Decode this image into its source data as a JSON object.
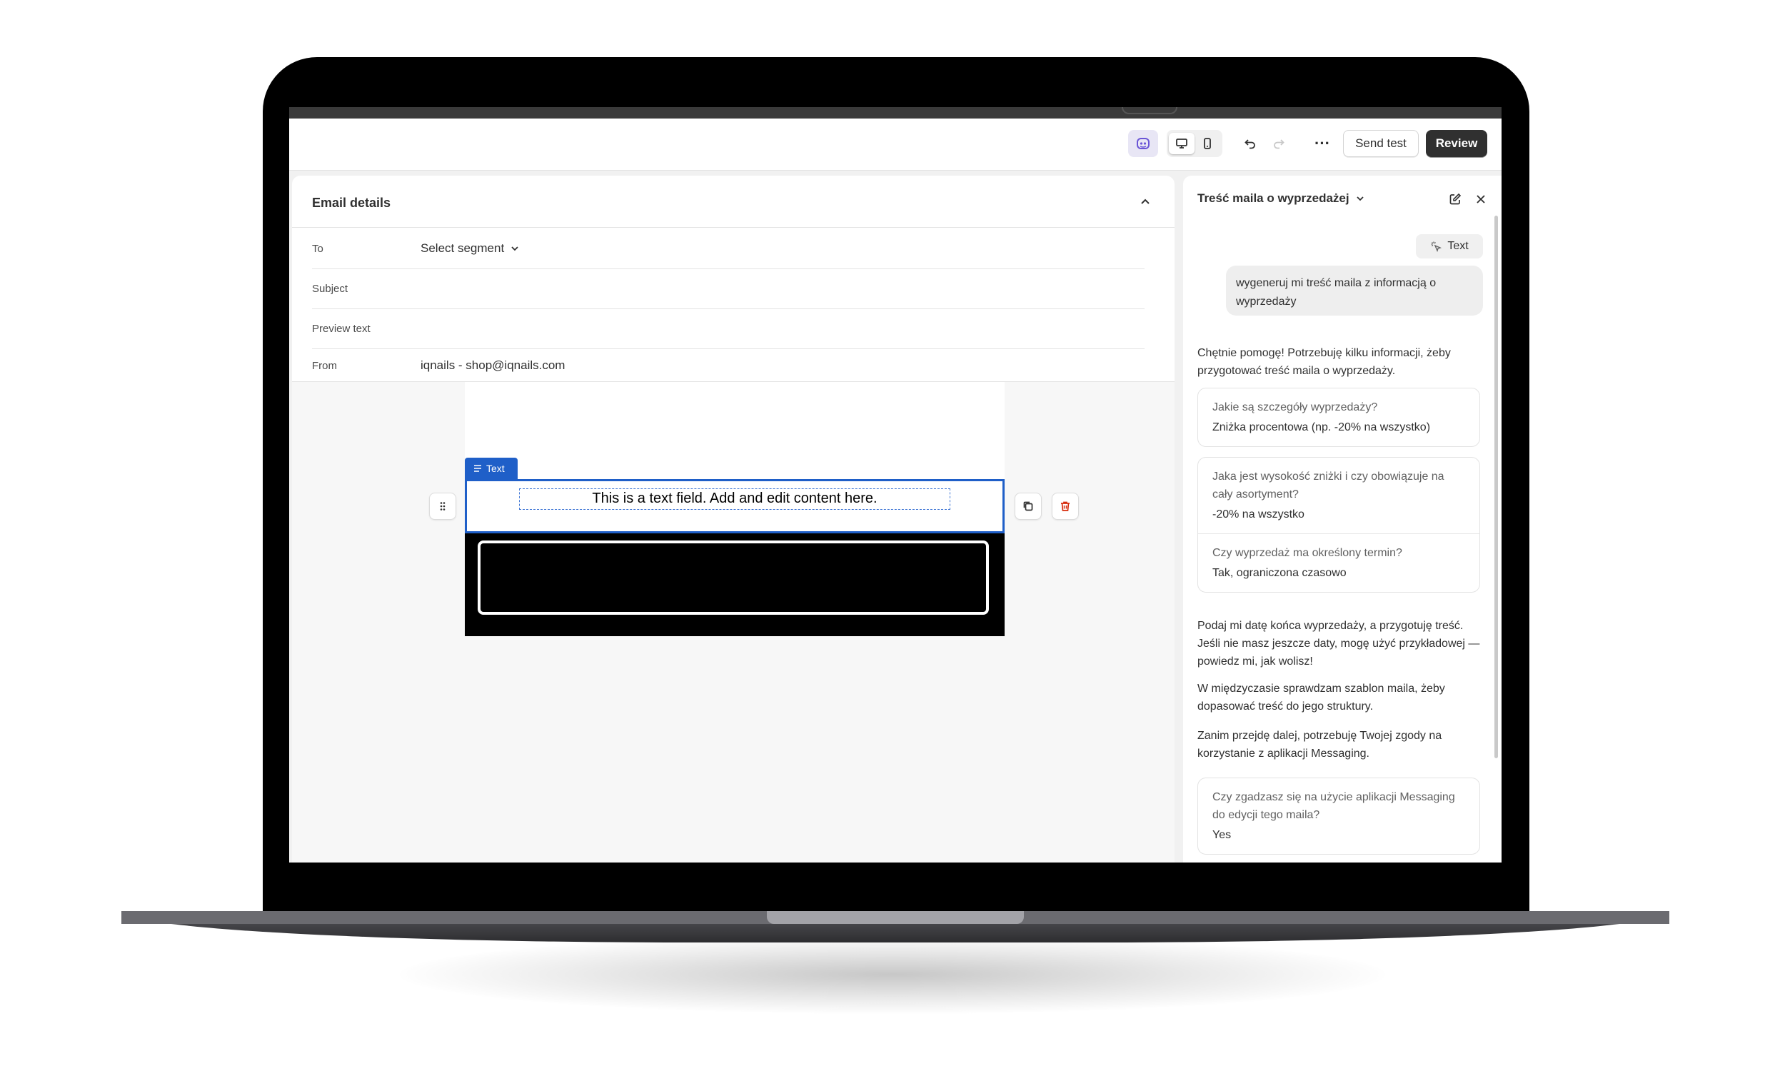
{
  "toolbar": {
    "send_test_label": "Send test",
    "review_label": "Review",
    "ai_icon": "sparkle-face-icon",
    "desktop_icon": "desktop-icon",
    "mobile_icon": "mobile-icon",
    "more_label": "···"
  },
  "email_details": {
    "title": "Email details",
    "fields": [
      {
        "label": "To",
        "value": "Select segment"
      },
      {
        "label": "Subject",
        "value": ""
      },
      {
        "label": "Preview text",
        "value": ""
      },
      {
        "label": "From",
        "value": "iqnails - shop@iqnails.com"
      }
    ]
  },
  "editor": {
    "block_tag": "Text",
    "text_field": "This is a text field. Add and edit content here."
  },
  "assistant": {
    "title": "Treść maila o wyprzedażej",
    "chip_label": "Text",
    "user_message": "wygeneruj mi treść maila z informacją o wyprzedaży",
    "reply_1": "Chętnie pomogę! Potrzebuję kilku informacji, żeby przygotować treść maila o wyprzedaży.",
    "qa_1": [
      {
        "q": "Jakie są szczegóły wyprzedaży?",
        "a": "Zniżka procentowa (np. -20% na wszystko)"
      }
    ],
    "qa_2": [
      {
        "q": "Jaka jest wysokość zniżki i czy obowiązuje na cały asortyment?",
        "a": "-20% na wszystko"
      },
      {
        "q": "Czy wyprzedaż ma określony termin?",
        "a": "Tak, ograniczona czasowo"
      }
    ],
    "reply_2": "Podaj mi datę końca wyprzedaży, a przygotuję treść. Jeśli nie masz jeszcze daty, mogę użyć przykładowej — powiedz mi, jak wolisz!",
    "reply_3": "W międzyczasie sprawdzam szablon maila, żeby dopasować treść do jego struktury.",
    "reply_4": "Zanim przejdę dalej, potrzebuję Twojej zgody na korzystanie z aplikacji Messaging.",
    "qa_3": [
      {
        "q": "Czy zgadzasz się na użycie aplikacji Messaging do edycji tego maila?",
        "a": "Yes"
      }
    ]
  },
  "colors": {
    "accent_blue": "#1f5fc8",
    "primary_button": "#303030",
    "delete_red": "#d72c0d"
  }
}
